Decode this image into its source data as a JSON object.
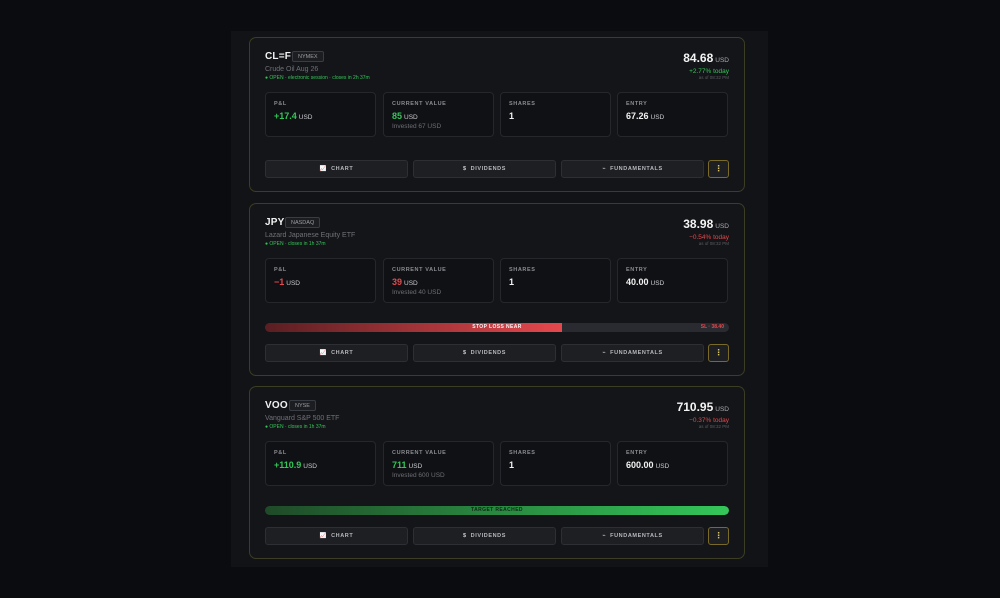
{
  "cards": [
    {
      "symbol": "CL=F",
      "exchange": "NYMEX",
      "name": "Crude Oil Aug 26",
      "status": "● OPEN · electronic session · closes in 2h 37m",
      "price": "84.68",
      "currency": "USD",
      "change": "+2.77% today",
      "as_of": "as of 08:32 PM",
      "pnl": {
        "label": "P&L",
        "value": "+17.4",
        "unit": "USD"
      },
      "current_value": {
        "label": "CURRENT VALUE",
        "value": "85",
        "unit": "USD",
        "sub": "Invested 67 USD"
      },
      "shares": {
        "label": "SHARES",
        "value": "1"
      },
      "entry": {
        "label": "ENTRY",
        "value": "67.26",
        "unit": "USD"
      }
    },
    {
      "symbol": "JPY",
      "exchange": "NASDAQ",
      "name": "Lazard Japanese Equity ETF",
      "status": "● OPEN · closes in 1h 37m",
      "price": "38.98",
      "currency": "USD",
      "change": "−0.54% today",
      "as_of": "as of 08:32 PM",
      "pnl": {
        "label": "P&L",
        "value": "−1",
        "unit": "USD"
      },
      "current_value": {
        "label": "CURRENT VALUE",
        "value": "39",
        "unit": "USD",
        "sub": "Invested 40 USD"
      },
      "shares": {
        "label": "SHARES",
        "value": "1"
      },
      "entry": {
        "label": "ENTRY",
        "value": "40.00",
        "unit": "USD"
      },
      "alert_bar": {
        "label": "STOP LOSS NEAR",
        "right_label": "SL · 38.40",
        "progress": 0.64
      }
    },
    {
      "symbol": "VOO",
      "exchange": "NYSE",
      "name": "Vanguard S&P 500 ETF",
      "status": "● OPEN · closes in 1h 37m",
      "price": "710.95",
      "currency": "USD",
      "change": "−0.37% today",
      "as_of": "as of 08:32 PM",
      "pnl": {
        "label": "P&L",
        "value": "+110.9",
        "unit": "USD"
      },
      "current_value": {
        "label": "CURRENT VALUE",
        "value": "711",
        "unit": "USD",
        "sub": "Invested 600 USD"
      },
      "shares": {
        "label": "SHARES",
        "value": "1"
      },
      "entry": {
        "label": "ENTRY",
        "value": "600.00",
        "unit": "USD"
      },
      "alert_bar": {
        "label": "TARGET REACHED",
        "progress": 1.0
      }
    }
  ],
  "actions": {
    "chart": "CHART",
    "chart_icon": "📈",
    "dividends": "DIVIDENDS",
    "dividends_icon": "$",
    "fundamentals": "FUNDAMENTALS",
    "fundamentals_icon": "⌁",
    "more": "⋮"
  },
  "colors": {
    "positive": "#34c759",
    "negative": "#e5484d",
    "accent_border": "#3b3d24"
  }
}
